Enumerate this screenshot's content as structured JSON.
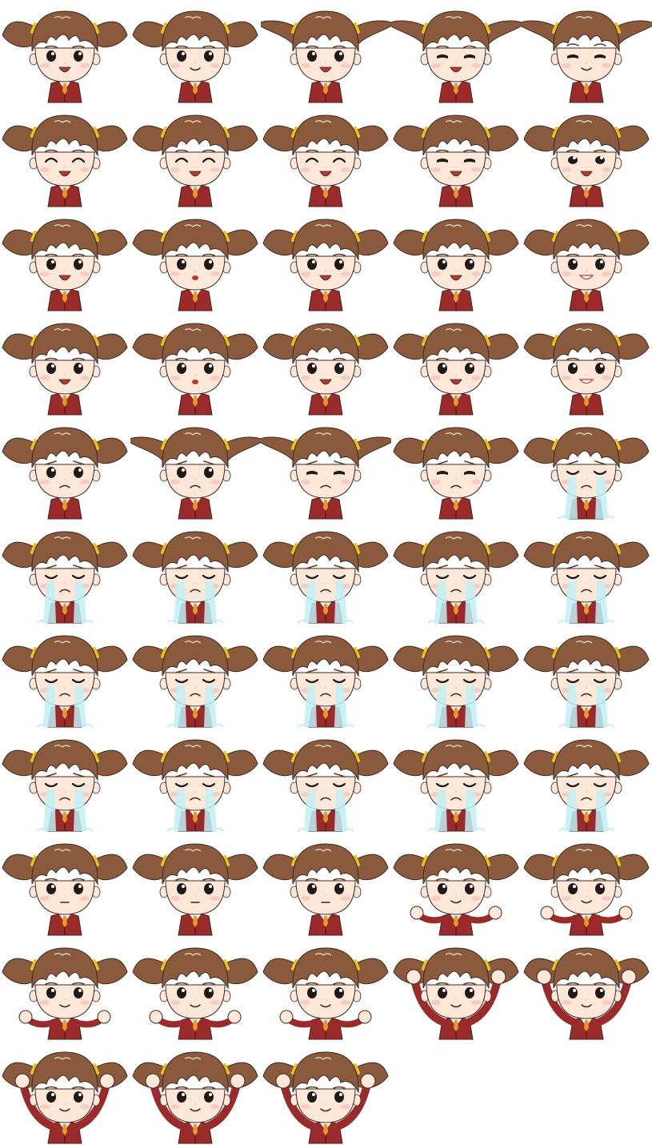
{
  "sheet": {
    "columns": 5,
    "rows": 11,
    "frame_count": 53,
    "background": "#ffffff"
  },
  "colors": {
    "hair": "#8b5a3c",
    "hair_dark": "#5e3a22",
    "hair_tie": "#e8c31a",
    "skin": "#fde7d8",
    "skin_shade": "#f2c9b2",
    "blush": "#f7b9b0",
    "uniform": "#9b2a2a",
    "uniform_dark": "#6e1a1a",
    "collar": "#ffffff",
    "tie": "#e29a2b",
    "eye": "#1f1a18",
    "mouth": "#b33a2e",
    "tears": "#bff0f6",
    "outline": "#3a2a22"
  },
  "frames": [
    {
      "pigtails": "normal",
      "eyes": "open",
      "brows": "normal",
      "mouth": "open-smile",
      "arms": "none",
      "tears": false
    },
    {
      "pigtails": "normal",
      "eyes": "open",
      "brows": "normal",
      "mouth": "smile",
      "arms": "none",
      "tears": false
    },
    {
      "pigtails": "wide",
      "eyes": "open",
      "brows": "normal",
      "mouth": "open-smile",
      "arms": "none",
      "tears": false
    },
    {
      "pigtails": "wide",
      "eyes": "half",
      "brows": "normal",
      "mouth": "open-smile",
      "arms": "none",
      "tears": false
    },
    {
      "pigtails": "wide",
      "eyes": "half",
      "brows": "raised",
      "mouth": "smile",
      "arms": "none",
      "tears": false
    },
    {
      "pigtails": "normal",
      "eyes": "closed-happy",
      "brows": "normal",
      "mouth": "open-smile",
      "arms": "none",
      "tears": false
    },
    {
      "pigtails": "normal",
      "eyes": "closed-happy",
      "brows": "normal",
      "mouth": "open-smile",
      "arms": "none",
      "tears": false
    },
    {
      "pigtails": "normal",
      "eyes": "closed-happy",
      "brows": "normal",
      "mouth": "open-smile",
      "arms": "none",
      "tears": false
    },
    {
      "pigtails": "normal",
      "eyes": "half",
      "brows": "normal",
      "mouth": "open-smile",
      "arms": "none",
      "tears": false
    },
    {
      "pigtails": "normal",
      "eyes": "half-open",
      "brows": "normal",
      "mouth": "open-smile",
      "arms": "none",
      "tears": false
    },
    {
      "pigtails": "normal",
      "eyes": "open",
      "brows": "normal",
      "mouth": "open-smile",
      "arms": "none",
      "tears": false
    },
    {
      "pigtails": "normal",
      "eyes": "open",
      "brows": "normal",
      "mouth": "open-small",
      "arms": "none",
      "tears": false
    },
    {
      "pigtails": "normal",
      "eyes": "open",
      "brows": "normal",
      "mouth": "open-smile",
      "arms": "none",
      "tears": false
    },
    {
      "pigtails": "normal",
      "eyes": "open",
      "brows": "normal",
      "mouth": "open-smile",
      "arms": "none",
      "tears": false
    },
    {
      "pigtails": "normal",
      "eyes": "open",
      "brows": "normal",
      "mouth": "smile-teeth",
      "arms": "none",
      "tears": false
    },
    {
      "pigtails": "normal",
      "eyes": "open",
      "brows": "normal",
      "mouth": "open-smile",
      "arms": "none",
      "tears": false
    },
    {
      "pigtails": "normal",
      "eyes": "open",
      "brows": "normal",
      "mouth": "open-small",
      "arms": "none",
      "tears": false
    },
    {
      "pigtails": "normal",
      "eyes": "open",
      "brows": "normal",
      "mouth": "open-smile",
      "arms": "none",
      "tears": false
    },
    {
      "pigtails": "normal",
      "eyes": "open",
      "brows": "normal",
      "mouth": "open-smile",
      "arms": "none",
      "tears": false
    },
    {
      "pigtails": "normal",
      "eyes": "open",
      "brows": "normal",
      "mouth": "smile-teeth",
      "arms": "none",
      "tears": false
    },
    {
      "pigtails": "normal",
      "eyes": "open",
      "brows": "worried",
      "mouth": "frown",
      "arms": "none",
      "tears": false
    },
    {
      "pigtails": "wide",
      "eyes": "open",
      "brows": "worried",
      "mouth": "frown",
      "arms": "none",
      "tears": false
    },
    {
      "pigtails": "wide",
      "eyes": "half",
      "brows": "worried",
      "mouth": "frown",
      "arms": "none",
      "tears": false
    },
    {
      "pigtails": "normal",
      "eyes": "half",
      "brows": "worried",
      "mouth": "frown",
      "arms": "none",
      "tears": false
    },
    {
      "pigtails": "normal",
      "eyes": "closed-sad",
      "brows": "worried",
      "mouth": "frown",
      "arms": "none",
      "tears": true
    },
    {
      "pigtails": "normal",
      "eyes": "closed-sad",
      "brows": "worried",
      "mouth": "frown",
      "arms": "none",
      "tears": true
    },
    {
      "pigtails": "normal",
      "eyes": "closed-sad",
      "brows": "worried",
      "mouth": "frown",
      "arms": "none",
      "tears": true
    },
    {
      "pigtails": "normal",
      "eyes": "closed-sad",
      "brows": "worried",
      "mouth": "frown",
      "arms": "none",
      "tears": true
    },
    {
      "pigtails": "normal",
      "eyes": "closed-sad",
      "brows": "worried",
      "mouth": "frown",
      "arms": "none",
      "tears": true
    },
    {
      "pigtails": "normal",
      "eyes": "closed-sad",
      "brows": "worried",
      "mouth": "frown",
      "arms": "none",
      "tears": true
    },
    {
      "pigtails": "normal",
      "eyes": "closed-sad",
      "brows": "worried",
      "mouth": "frown",
      "arms": "none",
      "tears": true
    },
    {
      "pigtails": "normal",
      "eyes": "closed-sad",
      "brows": "worried",
      "mouth": "frown",
      "arms": "none",
      "tears": true
    },
    {
      "pigtails": "normal",
      "eyes": "closed-sad",
      "brows": "worried",
      "mouth": "frown",
      "arms": "none",
      "tears": true
    },
    {
      "pigtails": "normal",
      "eyes": "closed-sad",
      "brows": "worried",
      "mouth": "frown",
      "arms": "none",
      "tears": true
    },
    {
      "pigtails": "normal",
      "eyes": "closed-sad",
      "brows": "worried",
      "mouth": "frown",
      "arms": "none",
      "tears": true
    },
    {
      "pigtails": "normal",
      "eyes": "closed-sad",
      "brows": "worried",
      "mouth": "frown",
      "arms": "none",
      "tears": true
    },
    {
      "pigtails": "normal",
      "eyes": "closed-sad",
      "brows": "worried",
      "mouth": "frown",
      "arms": "none",
      "tears": true
    },
    {
      "pigtails": "normal",
      "eyes": "closed-sad",
      "brows": "worried",
      "mouth": "frown",
      "arms": "none",
      "tears": true
    },
    {
      "pigtails": "normal",
      "eyes": "closed-sad",
      "brows": "worried",
      "mouth": "frown",
      "arms": "none",
      "tears": true
    },
    {
      "pigtails": "normal",
      "eyes": "closed-sad",
      "brows": "worried",
      "mouth": "frown",
      "arms": "none",
      "tears": true
    },
    {
      "pigtails": "normal",
      "eyes": "open",
      "brows": "normal",
      "mouth": "neutral",
      "arms": "none",
      "tears": false
    },
    {
      "pigtails": "normal",
      "eyes": "open",
      "brows": "normal",
      "mouth": "neutral",
      "arms": "none",
      "tears": false
    },
    {
      "pigtails": "normal",
      "eyes": "open",
      "brows": "normal",
      "mouth": "neutral",
      "arms": "none",
      "tears": false
    },
    {
      "pigtails": "normal",
      "eyes": "open",
      "brows": "normal",
      "mouth": "smile",
      "arms": "fists-low",
      "tears": false
    },
    {
      "pigtails": "normal",
      "eyes": "open",
      "brows": "normal",
      "mouth": "smile",
      "arms": "fists-low",
      "tears": false
    },
    {
      "pigtails": "normal",
      "eyes": "open",
      "brows": "normal",
      "mouth": "smile",
      "arms": "fists-low",
      "tears": false
    },
    {
      "pigtails": "normal",
      "eyes": "open",
      "brows": "normal",
      "mouth": "smile",
      "arms": "fists-low",
      "tears": false
    },
    {
      "pigtails": "normal",
      "eyes": "open",
      "brows": "normal",
      "mouth": "smile",
      "arms": "fists-low",
      "tears": false
    },
    {
      "pigtails": "normal",
      "eyes": "open",
      "brows": "normal",
      "mouth": "smile",
      "arms": "fists-up",
      "tears": false
    },
    {
      "pigtails": "normal",
      "eyes": "open",
      "brows": "normal",
      "mouth": "smile",
      "arms": "fists-up",
      "tears": false
    },
    {
      "pigtails": "normal",
      "eyes": "open",
      "brows": "normal",
      "mouth": "smile",
      "arms": "fists-up",
      "tears": false
    },
    {
      "pigtails": "normal",
      "eyes": "open",
      "brows": "normal",
      "mouth": "smile",
      "arms": "fists-up",
      "tears": false
    },
    {
      "pigtails": "normal",
      "eyes": "open",
      "brows": "normal",
      "mouth": "smile",
      "arms": "fists-up",
      "tears": false
    }
  ]
}
